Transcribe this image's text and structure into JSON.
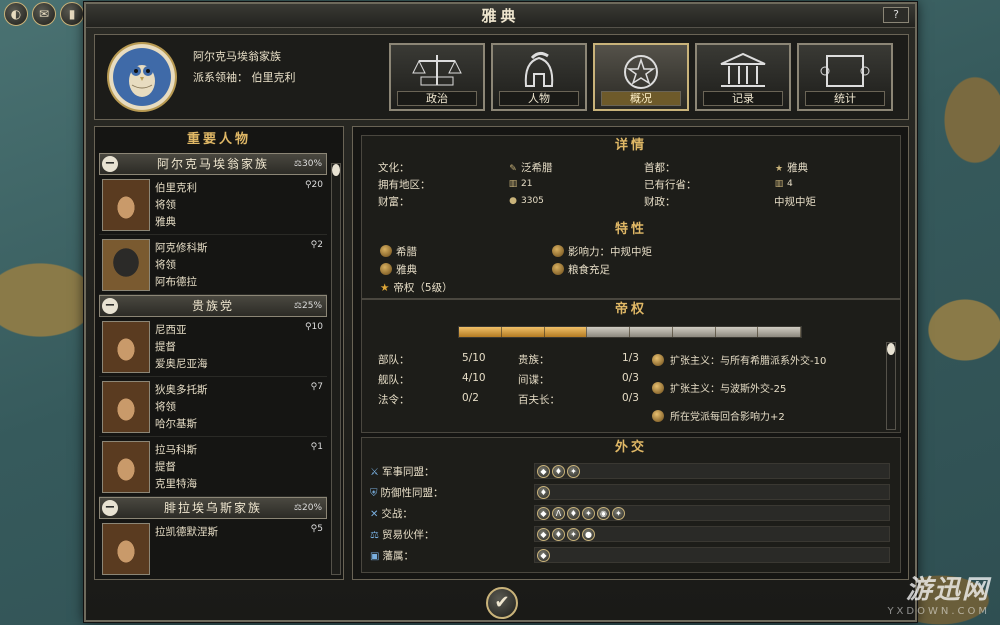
{
  "window": {
    "title": "雅典",
    "help_label": "?"
  },
  "top_icons": [
    {
      "name": "advisor-icon",
      "glyph": "◐"
    },
    {
      "name": "diplomacy-icon",
      "glyph": "✉"
    },
    {
      "name": "book-icon",
      "glyph": "▮"
    },
    {
      "name": "quill-icon",
      "glyph": "✎"
    },
    {
      "name": "faction-icon",
      "glyph": "⚑"
    }
  ],
  "faction": {
    "name": "阿尔克马埃翁家族",
    "leader_label": "派系领袖：",
    "leader_name": "伯里克利"
  },
  "tabs": [
    {
      "label": "政治",
      "icon": "scales-icon"
    },
    {
      "label": "人物",
      "icon": "helmet-icon"
    },
    {
      "label": "概况",
      "icon": "laurel-star-icon"
    },
    {
      "label": "记录",
      "icon": "temple-icon"
    },
    {
      "label": "统计",
      "icon": "scroll-icon"
    }
  ],
  "left": {
    "heading": "重要人物",
    "groups": [
      {
        "name": "阿尔克马埃翁家族",
        "pct": "30%",
        "people": [
          {
            "name": "伯里克利",
            "role": "将领",
            "place": "雅典",
            "count": "20",
            "helmet": false
          },
          {
            "name": "阿克修科斯",
            "role": "将领",
            "place": "阿布德拉",
            "count": "2",
            "helmet": true
          }
        ]
      },
      {
        "name": "贵族党",
        "pct": "25%",
        "people": [
          {
            "name": "尼西亚",
            "role": "提督",
            "place": "爱奥尼亚海",
            "count": "10",
            "helmet": false
          },
          {
            "name": "狄奥多托斯",
            "role": "将领",
            "place": "哈尔基斯",
            "count": "7",
            "helmet": false
          },
          {
            "name": "拉马科斯",
            "role": "提督",
            "place": "克里特海",
            "count": "1",
            "helmet": false
          }
        ]
      },
      {
        "name": "腓拉埃乌斯家族",
        "pct": "20%",
        "people": [
          {
            "name": "拉凯德默涅斯",
            "role": "",
            "place": "",
            "count": "5",
            "helmet": false
          }
        ]
      }
    ]
  },
  "details": {
    "heading": "详情",
    "culture_label": "文化：",
    "culture_value": "泛希腊",
    "capital_label": "首都：",
    "capital_value": "雅典",
    "regions_label": "拥有地区：",
    "regions_value": "21",
    "provinces_label": "已有行省：",
    "provinces_value": "4",
    "wealth_label": "财富：",
    "wealth_value": "3305",
    "finance_label": "财政：",
    "finance_value": "中规中矩"
  },
  "traits": {
    "heading": "特性",
    "items": [
      {
        "text": "希腊"
      },
      {
        "text": "影响力：中规中矩"
      },
      {
        "text": "雅典"
      },
      {
        "text": "粮食充足"
      },
      {
        "text": "帝权（5级）",
        "star": true
      }
    ]
  },
  "imperium": {
    "heading": "帝权",
    "progress": 0.37,
    "stats": [
      {
        "label": "部队：",
        "value": "5/10",
        "label2": "贵族：",
        "value2": "1/3"
      },
      {
        "label": "舰队：",
        "value": "4/10",
        "label2": "间谍：",
        "value2": "0/3"
      },
      {
        "label": "法令：",
        "value": "0/2",
        "label2": "百夫长：",
        "value2": "0/3"
      }
    ],
    "effects": [
      "扩张主义：与所有希腊派系外交-10",
      "扩张主义：与波斯外交-25",
      "所在党派每回合影响力+2"
    ]
  },
  "diplomacy": {
    "heading": "外交",
    "rows": [
      {
        "label": "军事同盟：",
        "icon": "⚔",
        "coins": [
          "◆",
          "♦",
          "✦"
        ]
      },
      {
        "label": "防御性同盟：",
        "icon": "⛨",
        "coins": [
          "♦"
        ]
      },
      {
        "label": "交战：",
        "icon": "✕",
        "coins": [
          "◆",
          "Λ",
          "♦",
          "✦",
          "◉",
          "✦"
        ]
      },
      {
        "label": "贸易伙伴：",
        "icon": "⚖",
        "coins": [
          "◆",
          "♦",
          "✦",
          "●"
        ]
      },
      {
        "label": "藩属：",
        "icon": "▣",
        "coins": [
          "◆"
        ]
      }
    ]
  },
  "confirm": {
    "glyph": "✔"
  },
  "watermark": {
    "big": "游迅网",
    "small": "YXDOWN.COM"
  }
}
